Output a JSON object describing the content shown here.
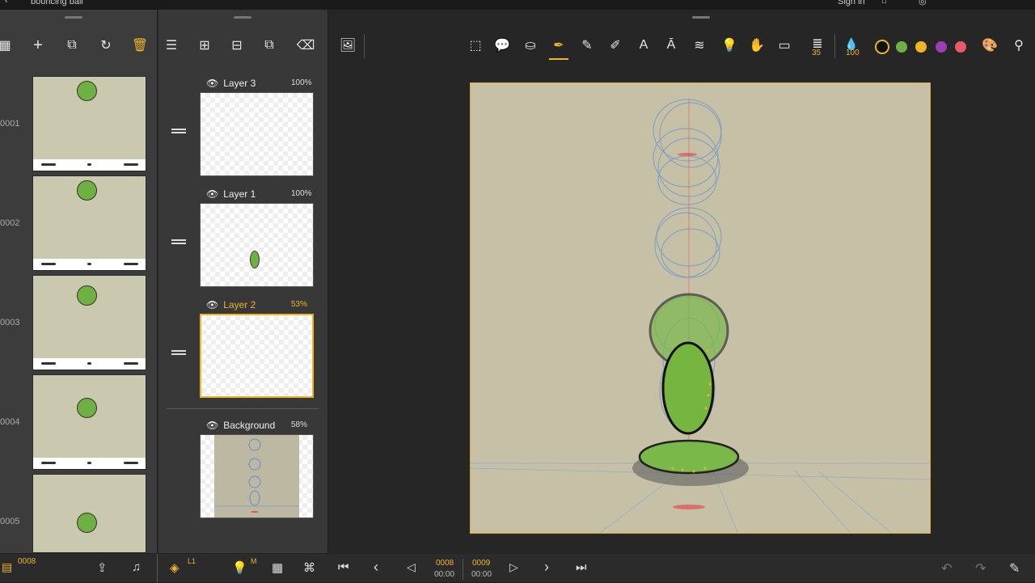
{
  "window": {
    "title": "bouncing ball",
    "signin": "Sign in"
  },
  "frames": {
    "current": "0008",
    "items": [
      {
        "num": "0001"
      },
      {
        "num": "0002"
      },
      {
        "num": "0003"
      },
      {
        "num": "0004"
      },
      {
        "num": "0005"
      }
    ]
  },
  "layers": {
    "indicator": "L1",
    "light_label": "M",
    "items": [
      {
        "name": "Layer 3",
        "opacity": "100%"
      },
      {
        "name": "Layer 1",
        "opacity": "100%"
      },
      {
        "name": "Layer 2",
        "opacity": "53%"
      },
      {
        "name": "Background",
        "opacity": "58%"
      }
    ]
  },
  "toolbar": {
    "brush_size": "35",
    "opacity": "100",
    "colors": [
      "#111111",
      "#6fb043",
      "#f0b429",
      "#9b3fb5",
      "#e85a6a"
    ]
  },
  "timeline": {
    "frame_a": "0008",
    "time_a": "00:00",
    "frame_b": "0009",
    "time_b": "00:00"
  },
  "colors": {
    "accent": "#f0b429",
    "selection": "#e0a93a"
  }
}
